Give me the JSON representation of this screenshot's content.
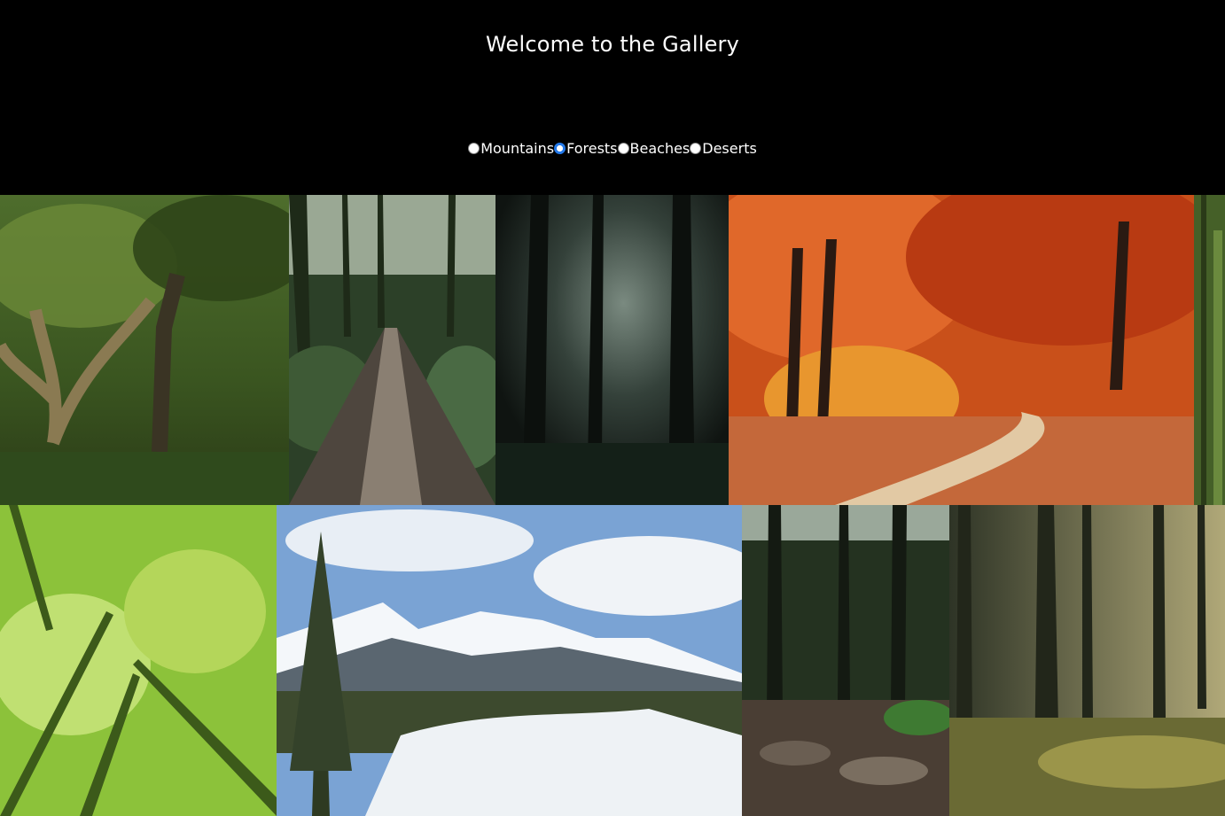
{
  "header": {
    "title": "Welcome to the Gallery"
  },
  "filters": [
    {
      "label": "Mountains",
      "checked": false
    },
    {
      "label": "Forests",
      "checked": true
    },
    {
      "label": "Beaches",
      "checked": false
    },
    {
      "label": "Deserts",
      "checked": false
    }
  ],
  "gallery": {
    "images": [
      {
        "subject": "mossy-oak-forest",
        "colors": [
          "#3d5a22",
          "#6e7f3a",
          "#2b3d18"
        ]
      },
      {
        "subject": "wooden-boardwalk-forest",
        "colors": [
          "#2f4a2a",
          "#5c5249",
          "#8fa07a"
        ]
      },
      {
        "subject": "misty-dark-forest",
        "colors": [
          "#151a17",
          "#3c4a44",
          "#6b7a70"
        ]
      },
      {
        "subject": "autumn-forest-path",
        "colors": [
          "#c94a14",
          "#e88a2a",
          "#d9b48a"
        ]
      },
      {
        "subject": "forest-edge-strip",
        "colors": [
          "#4c6b2a",
          "#2e4018",
          "#7a9a4a"
        ]
      },
      {
        "subject": "green-canopy-looking-up",
        "colors": [
          "#8cc23a",
          "#c6e06a",
          "#3f6a1a"
        ]
      },
      {
        "subject": "snowy-mountain-pines",
        "colors": [
          "#7aa3d4",
          "#e8eef5",
          "#3a4a3a"
        ]
      },
      {
        "subject": "forest-stream-rocks",
        "colors": [
          "#2c3a22",
          "#5a4a3c",
          "#4a7a3a"
        ]
      },
      {
        "subject": "sunlit-pine-forest",
        "colors": [
          "#3a3a2a",
          "#8a8a4a",
          "#c4b88a"
        ]
      }
    ]
  }
}
